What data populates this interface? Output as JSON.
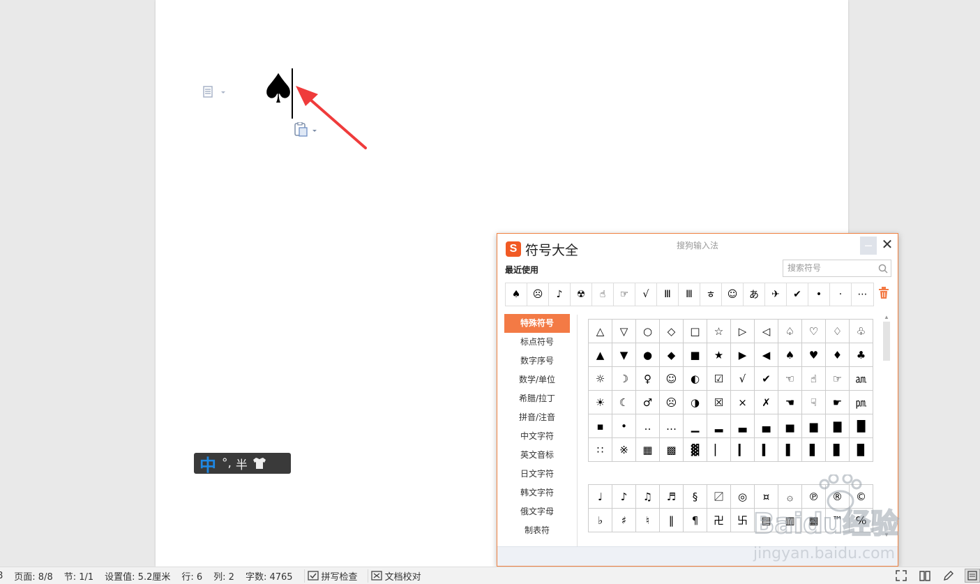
{
  "document": {
    "inserted_symbol": "♠"
  },
  "ime_bar": {
    "mode": "中",
    "punct": "°,",
    "width": "半"
  },
  "dialog": {
    "title": "符号大全",
    "subtitle": "搜狗输入法",
    "logo": "S",
    "minimize": "–",
    "close": "✕",
    "recent_label": "最近使用",
    "search_placeholder": "搜索符号",
    "recent_symbols": [
      "♠",
      "☹",
      "♪",
      "☢",
      "☝",
      "☞",
      "√",
      "Ⅲ",
      "Ⅲ",
      "ㅎ",
      "☺",
      "あ",
      "✈",
      "✔",
      "•",
      "·",
      "⋯"
    ],
    "categories": [
      "特殊符号",
      "标点符号",
      "数字序号",
      "数学/单位",
      "希腊/拉丁",
      "拼音/注音",
      "中文字符",
      "英文音标",
      "日文字符",
      "韩文字符",
      "俄文字母",
      "制表符"
    ],
    "active_category": 0,
    "symbols_grid1": [
      "△",
      "▽",
      "○",
      "◇",
      "□",
      "☆",
      "▷",
      "◁",
      "♤",
      "♡",
      "♢",
      "♧",
      "▲",
      "▼",
      "●",
      "◆",
      "■",
      "★",
      "▶",
      "◀",
      "♠",
      "♥",
      "♦",
      "♣",
      "☼",
      "☽",
      "♀",
      "☺",
      "◐",
      "☑",
      "√",
      "✔",
      "☜",
      "☝",
      "☞",
      "㏂",
      "☀",
      "☾",
      "♂",
      "☹",
      "◑",
      "☒",
      "×",
      "✗",
      "☚",
      "☟",
      "☛",
      "㏘",
      "▪",
      "•",
      "‥",
      "…",
      "▁",
      "▂",
      "▃",
      "▄",
      "▅",
      "▆",
      "▇",
      "█",
      "∷",
      "※",
      "▦",
      "▩",
      "▓",
      "▏",
      "▎",
      "▍",
      "▌",
      "▋",
      "▊",
      "▉"
    ],
    "symbols_grid2": [
      "♩",
      "♪",
      "♫",
      "♬",
      "§",
      "〼",
      "◎",
      "¤",
      "۞",
      "℗",
      "®",
      "©",
      "♭",
      "♯",
      "♮",
      "‖",
      "¶",
      "卍",
      "卐",
      "▤",
      "▥",
      "▦",
      "™",
      "℅"
    ]
  },
  "statusbar": {
    "page_num_fragment": "8",
    "page": "页面: 8/8",
    "section": "节: 1/1",
    "setting": "设置值: 5.2厘米",
    "row": "行: 6",
    "col": "列: 2",
    "words": "字数: 4765",
    "spell_check": "拼写检查",
    "doc_proof": "文档校对"
  },
  "watermark": {
    "brand": "Baidu经验",
    "url": "jingyan.baidu.com"
  }
}
